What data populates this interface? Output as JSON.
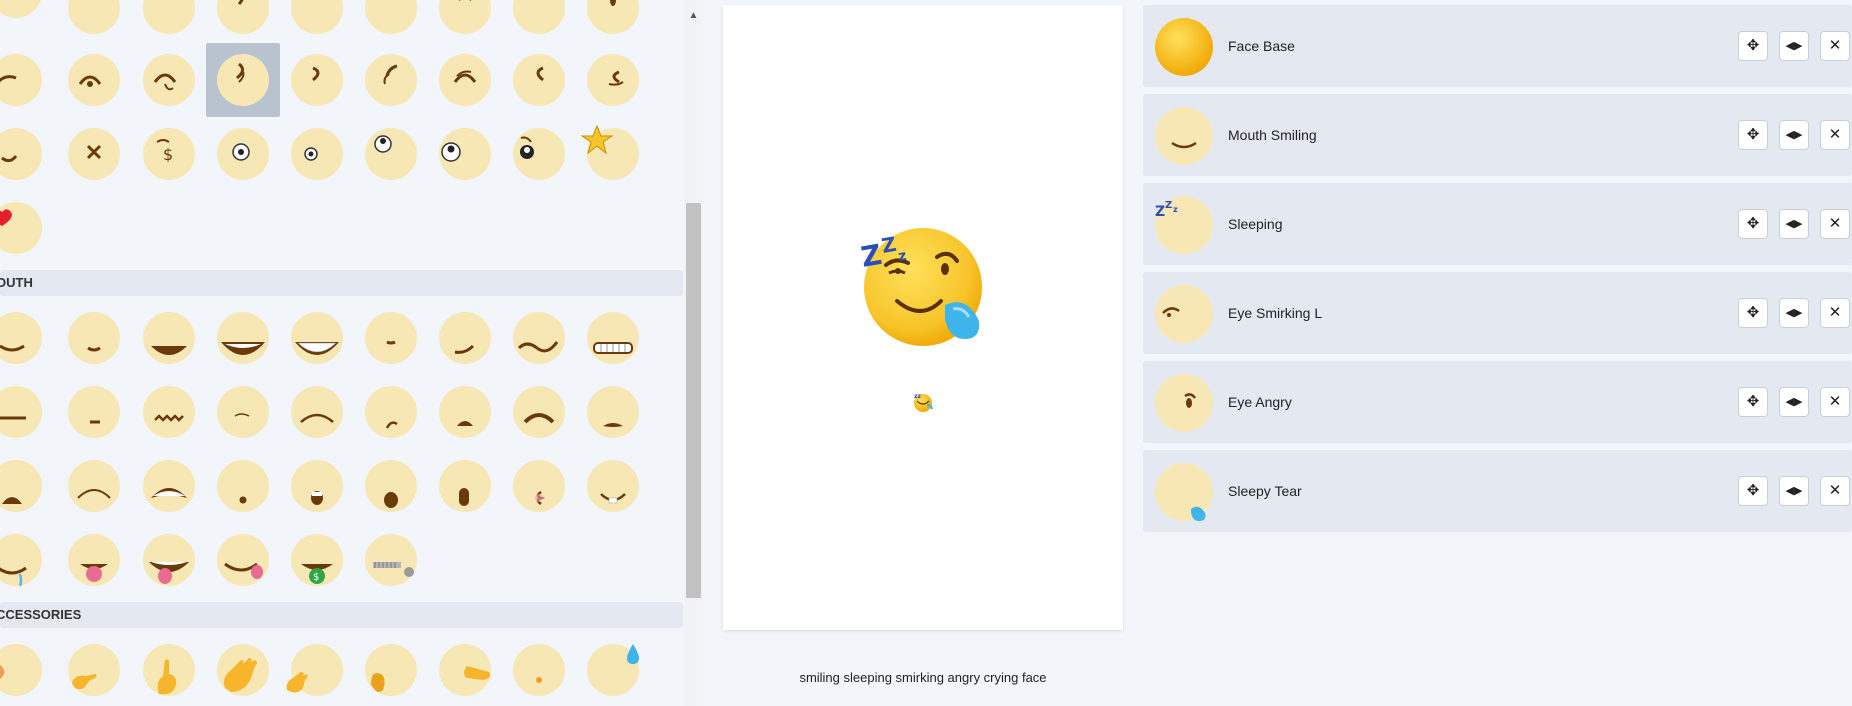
{
  "picker": {
    "sections": [
      {
        "title": "OUTH"
      },
      {
        "title": "CCESSORIES"
      }
    ]
  },
  "canvas": {
    "caption": "smiling sleeping smirking angry crying face",
    "colors": {
      "face": "#f7c52b",
      "tear": "#3fb4ea",
      "zzz": "#2a4fb8"
    }
  },
  "layers": [
    {
      "name": "Face Base",
      "thumb": "face-base"
    },
    {
      "name": "Mouth Smiling",
      "thumb": "mouth-smiling"
    },
    {
      "name": "Sleeping",
      "thumb": "sleeping"
    },
    {
      "name": "Eye Smirking L",
      "thumb": "eye-smirking-l"
    },
    {
      "name": "Eye Angry",
      "thumb": "eye-angry"
    },
    {
      "name": "Sleepy Tear",
      "thumb": "sleepy-tear"
    }
  ],
  "layer_buttons": {
    "move": "move-icon",
    "flip": "flip-horizontal-icon",
    "remove": "close-icon"
  }
}
